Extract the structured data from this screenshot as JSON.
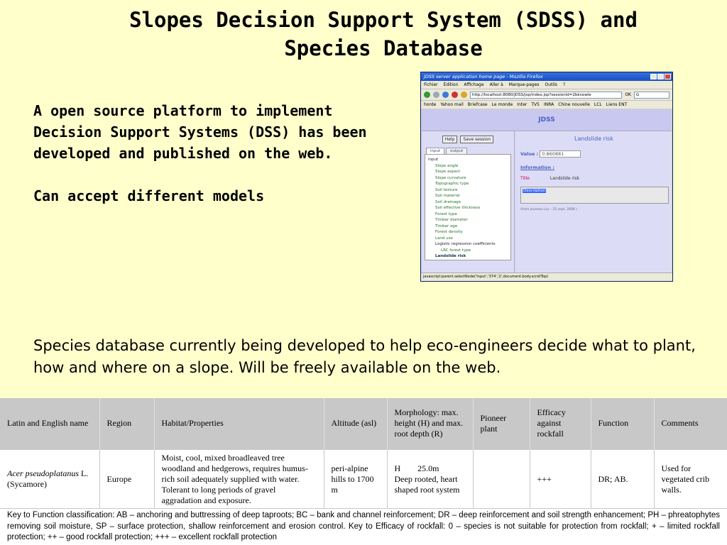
{
  "title": "Slopes Decision Support System (SDSS) and Species Database",
  "intro": {
    "line1": "A open source platform to implement Decision Support Systems (DSS) has been developed and published on the web.",
    "line2": "Can accept different models"
  },
  "species_text": "Species database currently being developed to help eco-engineers decide what to plant, how and where on a slope. Will be freely available on the web.",
  "browser": {
    "window_title": "JDSS server application home page - Mozilla Firefox",
    "menu": [
      "Fichier",
      "Édition",
      "Affichage",
      "Aller à",
      "Marque-pages",
      "Outils",
      "?"
    ],
    "url": "http://localhost:8080/JDSS/jsp/index.jsp?sessionId=2bknowle",
    "go_label": "OK",
    "search_value": "G",
    "bookmarks": [
      "horde",
      "Yahoo mail",
      "Briefcase",
      "Le monde",
      "Inter",
      "TV5",
      "INRA",
      "Chine nouvelle",
      "LCL",
      "Liens ENT"
    ],
    "app_title": "JDSS",
    "help_button": "Help",
    "save_button": "Save session",
    "tabs": [
      "input",
      "output"
    ],
    "tree": {
      "root": "input",
      "items": [
        "Slope angle",
        "Slope aspect",
        "Slope curvature",
        "Topographic type",
        "Soil texture",
        "Soil material",
        "Soil drainage",
        "Soil effective thickness",
        "Forest type",
        "Timber diameter",
        "Timber age",
        "Forest density",
        "Land use"
      ],
      "group": "Logistic regression coefficients",
      "group_child": "LRC forest type",
      "selected": "Landslide risk"
    },
    "result_title": "Landslide risk",
    "value_label": "Value :",
    "value": "0.860881",
    "information_label": "Information :",
    "title_label": "Title",
    "title_value": "Landslide risk",
    "description_value": "Description",
    "from_text": "(from Jouneau Luc - 25 sept. 2008 )",
    "status": "javascript:parent.selectNode('Input','374','2',document.body.scrollTop)"
  },
  "table": {
    "headers": [
      "Latin and English name",
      "Region",
      "Habitat/Properties",
      "Altitude (asl)",
      "Morphology: max. height (H) and max. root depth (R)",
      "Pioneer plant",
      "Efficacy against rockfall",
      "Function",
      "Comments"
    ],
    "row": {
      "latin": "Acer pseudoplatanus",
      "latin_suffix": " L.",
      "english": "(Sycamore)",
      "region": "Europe",
      "habitat": "Moist, cool, mixed broadleaved tree woodland and hedgerows, requires humus-rich soil adequately supplied with water. Tolerant to long periods of gravel aggradation and exposure.",
      "altitude": "peri-alpine hills to 1700 m",
      "morph_h": "H        25.0m",
      "morph_r": "Deep rooted, heart shaped root system",
      "pioneer": "",
      "efficacy": "+++",
      "function": "DR; AB.",
      "comments": "Used for vegetated crib walls."
    }
  },
  "key_text": "Key to Function classification: AB – anchoring and buttressing of deep taproots; BC – bank and channel reinforcement; DR – deep reinforcement and soil strength enhancement; PH – phreatophytes removing soil moisture, SP – surface protection, shallow reinforcement and erosion control. Key to Efficacy of rockfall: 0 – species is not suitable for protection from rockfall; + – limited rockfall protection; ++ – good rockfall protection; +++ – excellent rockfall protection"
}
